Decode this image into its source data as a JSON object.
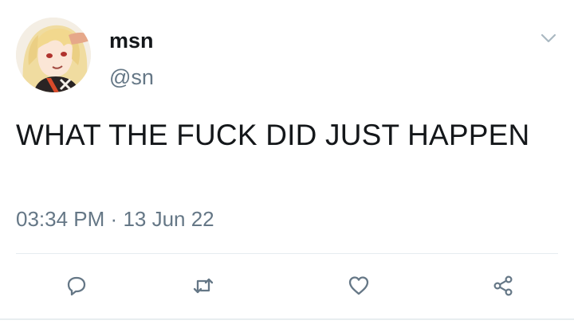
{
  "tweet": {
    "display_name": "msn",
    "handle": "@sn",
    "text": "WHAT THE FUCK DID JUST HAPPEN",
    "time": "03:34 PM",
    "separator": "·",
    "date": "13 Jun 22"
  },
  "icons": {
    "more": "chevron-down-icon",
    "reply": "reply-icon",
    "retweet": "retweet-icon",
    "like": "heart-icon",
    "share": "share-icon"
  },
  "colors": {
    "text": "#14171a",
    "secondary": "#657786",
    "icon": "#657786",
    "divider": "#e6ecf0"
  }
}
